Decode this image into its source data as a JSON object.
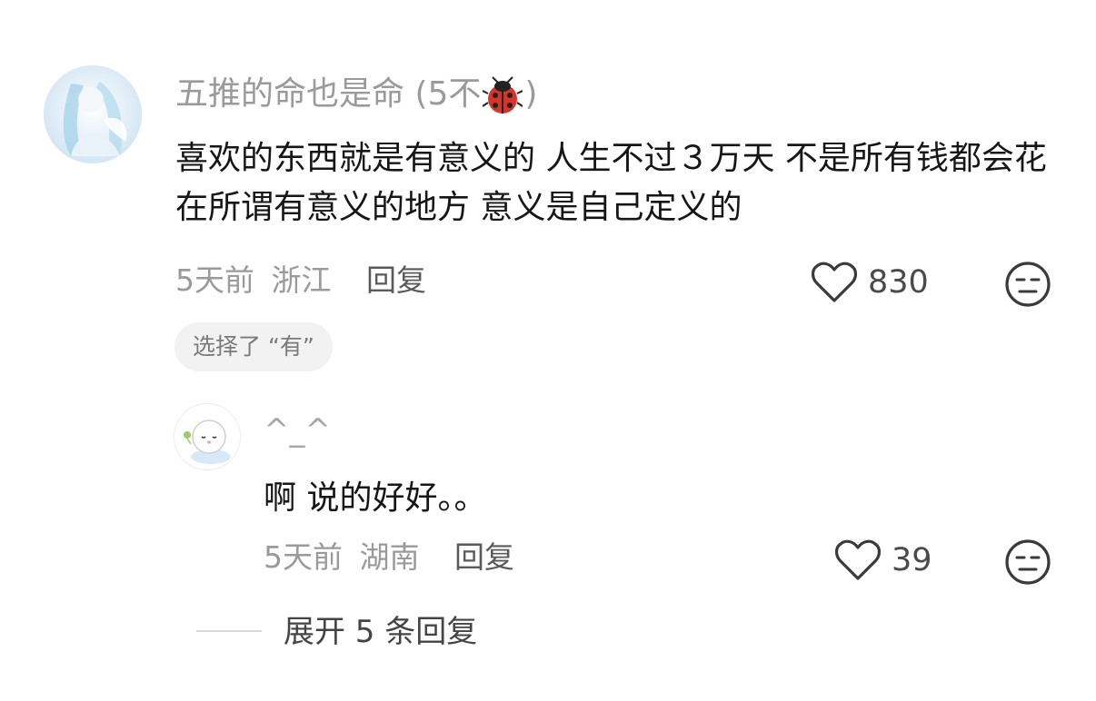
{
  "comment": {
    "username": "五推的命也是命 (5不",
    "username_suffix": ")",
    "username_emoji": "ladybug-icon",
    "text": "喜欢的东西就是有意义的 人生不过３万天 不是所有钱都会花在所谓有意义的地方 意义是自己定义的",
    "time": "5天前",
    "location": "浙江",
    "reply_label": "回复",
    "like_count": "830",
    "tag": "选择了 “有”"
  },
  "reply": {
    "username": "^_^",
    "text": "啊 说的好好。。",
    "time": "5天前",
    "location": "湖南",
    "reply_label": "回复",
    "like_count": "39"
  },
  "expand": {
    "label": "展开 5 条回复"
  },
  "colors": {
    "meta_gray": "#9a9a9a",
    "text_black": "#161616",
    "chip_bg": "#f2f2f2"
  }
}
